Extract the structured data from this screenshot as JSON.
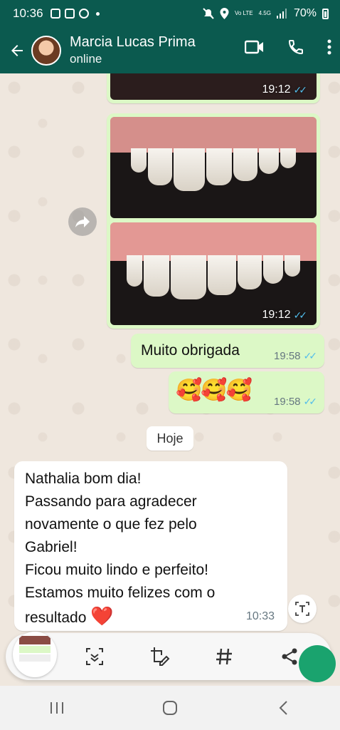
{
  "status_bar": {
    "time": "10:36",
    "battery": "70%",
    "network": "4.5G",
    "volte": "Vo LTE"
  },
  "header": {
    "contact_name": "Marcia Lucas Prima",
    "contact_status": "online"
  },
  "messages": [
    {
      "type": "image",
      "direction": "outgoing",
      "time": "19:12",
      "read": true
    },
    {
      "type": "image",
      "direction": "outgoing",
      "time": "19:12",
      "read": true
    },
    {
      "type": "text",
      "direction": "outgoing",
      "text": "Muito obrigada",
      "time": "19:58",
      "read": true
    },
    {
      "type": "text",
      "direction": "outgoing",
      "text": "🥰🥰🥰",
      "time": "19:58",
      "read": true
    },
    {
      "type": "text",
      "direction": "incoming",
      "lines": [
        "Nathalia bom dia!",
        "Passando para agradecer",
        "novamente o que fez pelo",
        "Gabriel!",
        "Ficou muito lindo e perfeito!",
        "Estamos muito felizes com o",
        "resultado"
      ],
      "emoji": "❤️",
      "time": "10:33"
    }
  ],
  "day_divider": "Hoje",
  "icons": {
    "back": "arrow-left-icon",
    "video": "video-call-icon",
    "call": "phone-icon",
    "menu": "more-vert-icon",
    "forward": "forward-icon",
    "translate": "text-recognition-icon"
  },
  "colors": {
    "header": "#0b5a4f",
    "outgoing_bubble": "#dcf8c6",
    "incoming_bubble": "#ffffff",
    "read_ticks": "#53bdeb",
    "wallpaper": "#efe7de"
  }
}
